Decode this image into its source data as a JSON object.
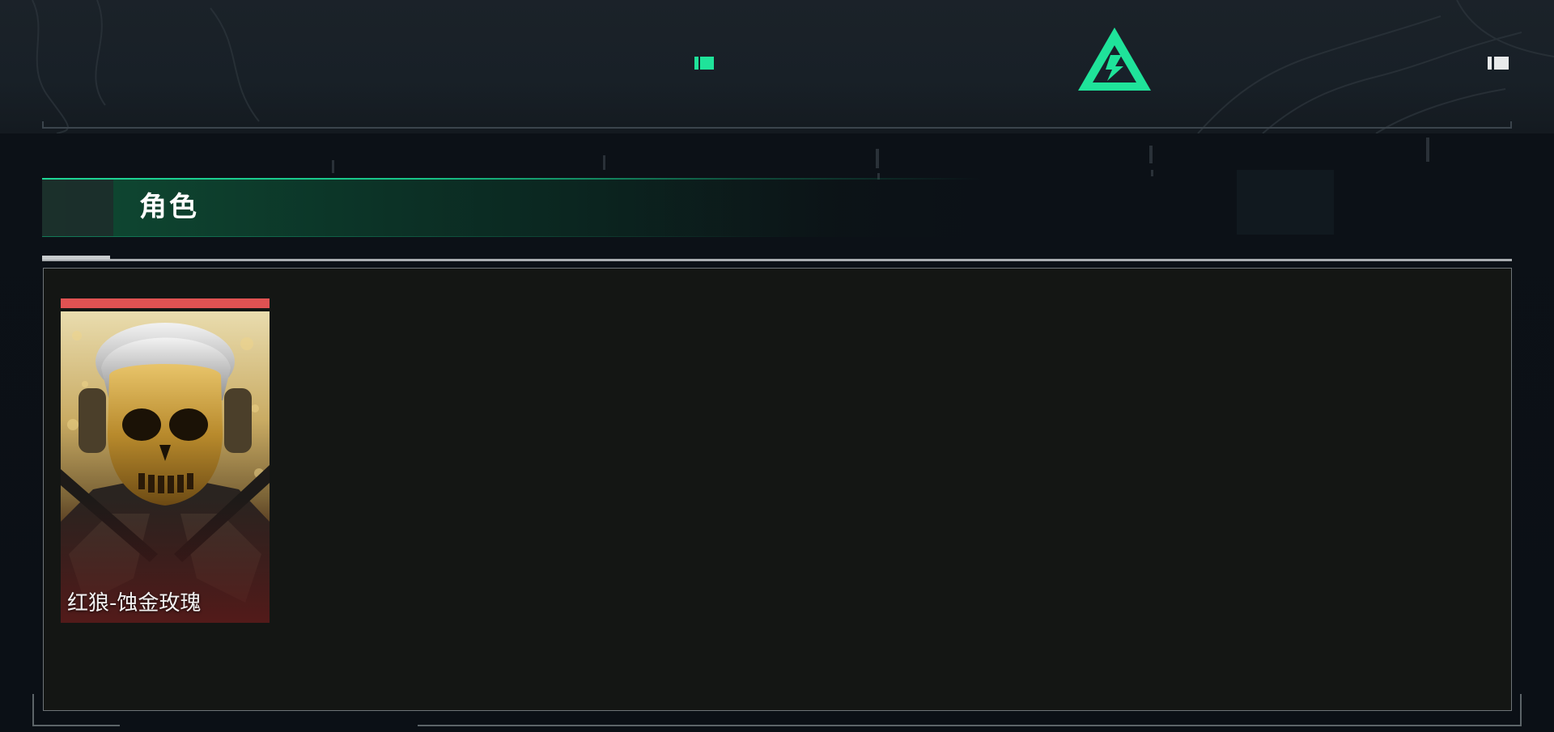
{
  "header": {
    "nav_left_icon": "tab-indicator-icon",
    "nav_right_icon": "tab-indicator-icon",
    "logo_icon": "triangle-lightning-logo",
    "accent_color": "#1fe39a"
  },
  "section": {
    "title": "角色"
  },
  "characters": [
    {
      "name": "红狼-蚀金玫瑰",
      "rarity_color": "#e05252",
      "portrait_icon": "gold-skull-mask-operator"
    }
  ]
}
